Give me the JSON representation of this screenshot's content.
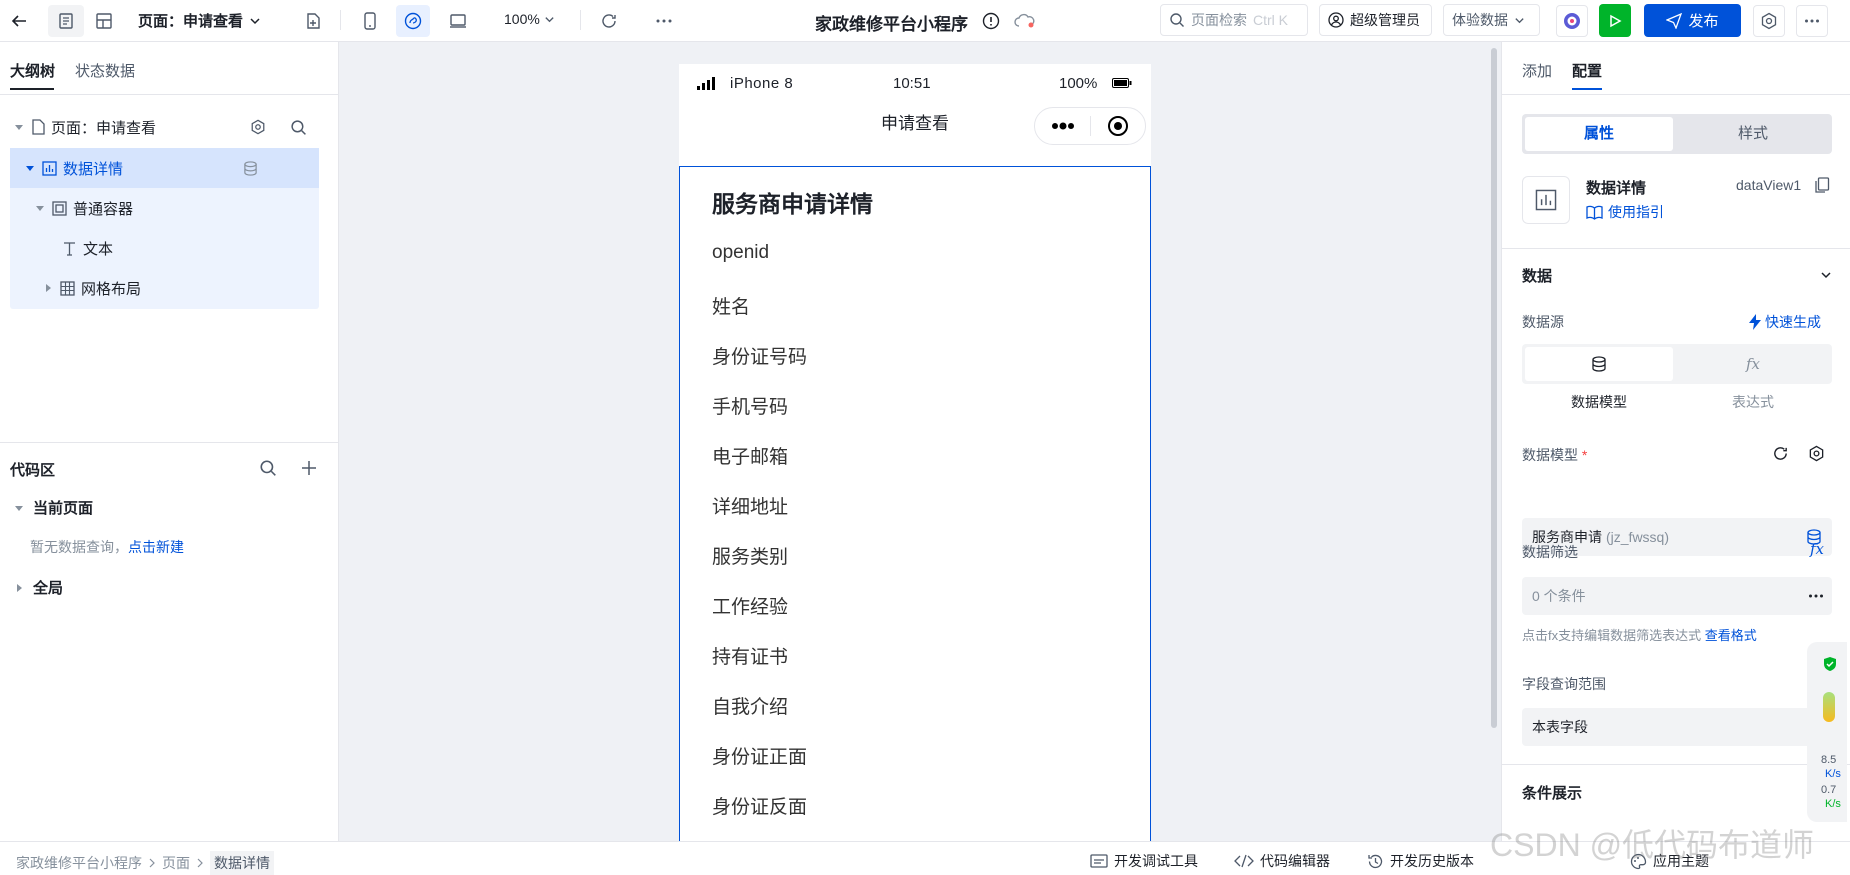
{
  "topbar": {
    "page_selector": "页面：申请查看",
    "zoom": "100%",
    "app_title": "家政维修平台小程序",
    "search_placeholder": "页面检索",
    "search_shortcut": "Ctrl K",
    "user_role": "超级管理员",
    "data_mode": "体验数据",
    "publish_label": "发布"
  },
  "left": {
    "tabs": [
      "大纲树",
      "状态数据"
    ],
    "tree": {
      "page": "页面：申请查看",
      "data_detail": "数据详情",
      "container": "普通容器",
      "text": "文本",
      "grid": "网格布局"
    },
    "code": {
      "title": "代码区",
      "current_page": "当前页面",
      "no_query": "暂无数据查询，",
      "new_link": "点击新建",
      "global": "全局"
    }
  },
  "phone": {
    "model": "iPhone 8",
    "time": "10:51",
    "battery": "100%",
    "nav_title": "申请查看",
    "heading": "服务商申请详情",
    "fields": [
      "openid",
      "姓名",
      "身份证号码",
      "手机号码",
      "电子邮箱",
      "详细地址",
      "服务类别",
      "工作经验",
      "持有证书",
      "自我介绍",
      "身份证正面",
      "身份证反面"
    ]
  },
  "right": {
    "tabs": [
      "添加",
      "配置"
    ],
    "seg": [
      "属性",
      "样式"
    ],
    "component_name": "数据详情",
    "component_id": "dataView1",
    "guide_link": "使用指引",
    "data_section": "数据",
    "datasource_label": "数据源",
    "quick_gen": "快速生成",
    "ds_options": [
      "数据模型",
      "表达式"
    ],
    "model_label": "数据模型",
    "model_value": "服务商申请",
    "model_code": "(jz_fwssq)",
    "filter_label": "数据筛选",
    "filter_value": "0 个条件",
    "filter_hint": "点击fx支持编辑数据筛选表达式",
    "filter_link": "查看格式",
    "scope_label": "字段查询范围",
    "scope_value": "本表字段",
    "cond_section": "条件展示"
  },
  "bottom": {
    "breadcrumb": [
      "家政维修平台小程序",
      "页面",
      "数据详情"
    ],
    "dev_tools": "开发调试工具",
    "code_editor": "代码编辑器",
    "history": "开发历史版本",
    "theme": "应用主题"
  },
  "watermark": "CSDN @低代码布道师",
  "monitor": {
    "up": "8.5",
    "up_unit": "K/s",
    "down": "0.7",
    "down_unit": "K/s"
  },
  "colors": {
    "primary": "#0052d9",
    "accent": "#00b42a",
    "canvas": "#eff1f5"
  }
}
